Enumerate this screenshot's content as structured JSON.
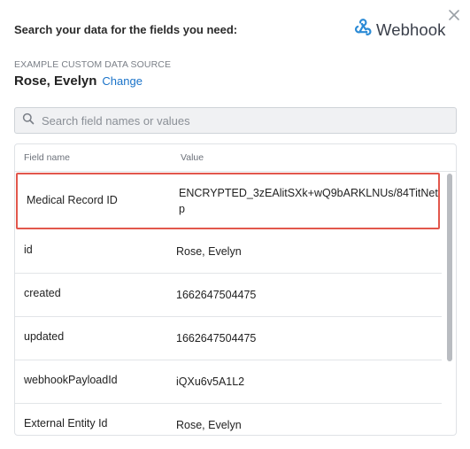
{
  "header": {
    "title": "Search your data for the fields you need:"
  },
  "brand": {
    "name": "Webhook",
    "icon": "webhook-icon"
  },
  "source": {
    "caption": "EXAMPLE CUSTOM DATA SOURCE",
    "name": "Rose, Evelyn",
    "change_label": "Change"
  },
  "search": {
    "placeholder": "Search field names or values",
    "value": ""
  },
  "table": {
    "columns": [
      "Field name",
      "Value"
    ],
    "rows": [
      {
        "field": "Medical Record ID",
        "value": "ENCRYPTED_3zEAlitSXk+wQ9bARKLNUs/84TitNetp"
      },
      {
        "field": "id",
        "value": "Rose, Evelyn"
      },
      {
        "field": "created",
        "value": "1662647504475"
      },
      {
        "field": "updated",
        "value": "1662647504475"
      },
      {
        "field": "webhookPayloadId",
        "value": "iQXu6v5A1L2"
      },
      {
        "field": "External Entity Id",
        "value": "Rose, Evelyn"
      }
    ]
  },
  "colors": {
    "link": "#1a73c9",
    "selection_border": "#e2574c",
    "search_bg": "#f0f1f3"
  }
}
